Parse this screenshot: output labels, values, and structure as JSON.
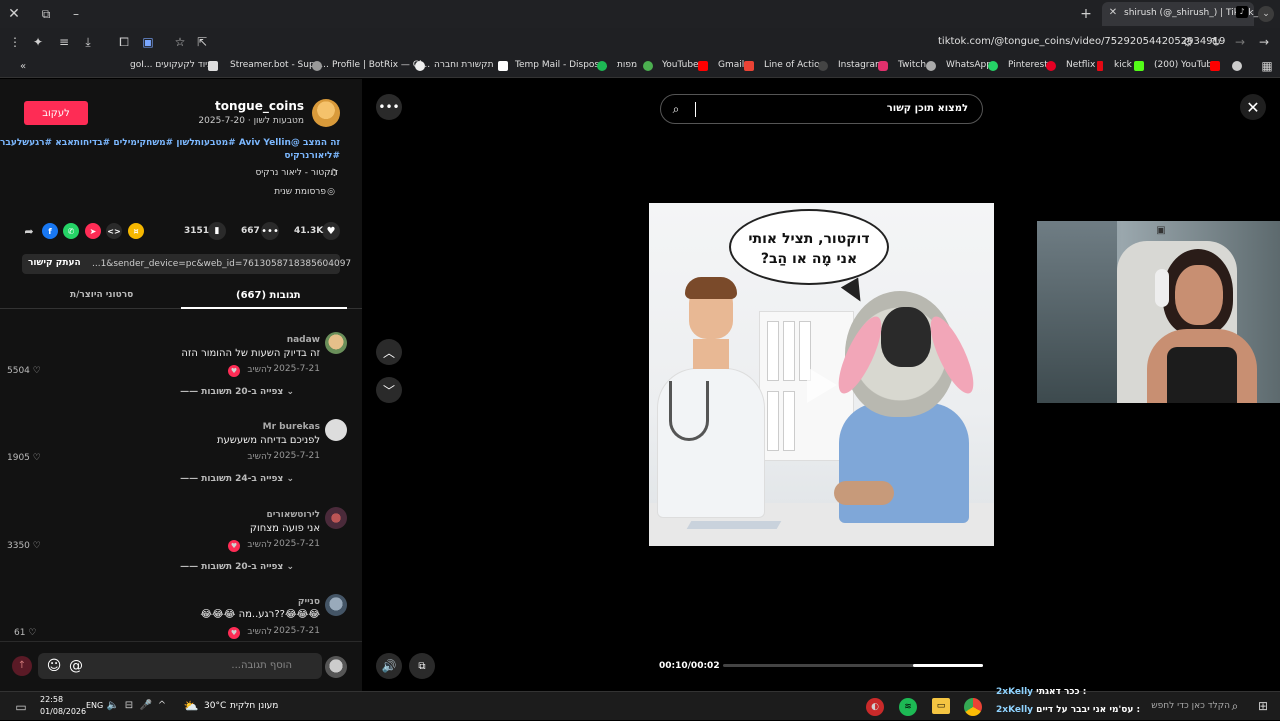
{
  "browser": {
    "tab_title": "shirush (@_shirush_) | TikTok_",
    "url": "tiktok.com/@tongue_coins/video/7529205442052934919",
    "bookmarks": [
      "goI... ציוד לקעקועים",
      "Streamer.bot - Supe...",
      "Profile | BotRix — Cl...",
      "תקשורת וחברה",
      "Temp Mail - Dispos...",
      "מפות",
      "YouTube",
      "Gmail",
      "Line of Action",
      "Instagram",
      "Twitch",
      "WhatsApp",
      "Pinterest",
      "Netflix",
      "kick",
      "(200) YouTube"
    ]
  },
  "post": {
    "username": "tongue_coins",
    "subtitle": "מטבעות לשון · 2025-7-20",
    "follow_label": "לעקוב",
    "description_line1": "זה המצב @Aviv Yellin #מטבעותלשון #משחקימילים #בדיחותאבא #רגעשלעברית",
    "description_line2": "#ליאורנרקיס",
    "music": "דוקטור - ליאור נרקיס",
    "promo": "פרסומת שנית",
    "likes": "41.3K",
    "comments": "667",
    "saves": "3151",
    "link_text": "...1&sender_device=pc&web_id=7613058718385604097",
    "copy_link_label": "העתק קישור",
    "tab_comments": "(667) תגובות",
    "tab_creator": "סרטוני היוצר/ת",
    "add_comment_placeholder": "הוסף תגובה..."
  },
  "comments": [
    {
      "name": "nadaw",
      "text": "זה בדיוק השעות של ההומור הזה",
      "date": "2025-7-21",
      "reply": "להשיב",
      "likes": "5504",
      "view_replies": "צפייה ב-20 תשובות"
    },
    {
      "name": "Mr burekas",
      "text": "לפניכם בדיחה משעשעת",
      "date": "2025-7-21",
      "reply": "להשיב",
      "likes": "1905",
      "view_replies": "צפייה ב-24 תשובות"
    },
    {
      "name": "לירוטשאורים",
      "text": "אני פועה מצחוק",
      "date": "2025-7-21",
      "reply": "להשיב",
      "likes": "3350",
      "view_replies": "צפייה ב-20 תשובות"
    },
    {
      "name": "סנייק",
      "text": "😂😂😂 רגע..מה??😂😂😂",
      "date": "2025-7-21",
      "reply": "להשיב",
      "likes": "61",
      "view_replies": ""
    }
  ],
  "video": {
    "search_placeholder": "למצוא תוכן קשור",
    "speech_line1": "דוקטור, תציל אותי",
    "speech_line2": "אני מָה או הַב?",
    "time": "00:10/00:02",
    "progress": 0.73
  },
  "taskbar": {
    "time": "22:58",
    "date": "01/08/2026",
    "lang": "ENG",
    "weather": "30°C",
    "weather_label": "מעונן חלקית",
    "search_placeholder": "הקלד כאן כדי לחפש",
    "chat1_name": "2xKelly",
    "chat1_text": "ככר דאגתי :",
    "chat2_name": "2xKelly",
    "chat2_text": "עס'מי אני יבבר על דיים :"
  },
  "colors": {
    "follow": "#fe2c55",
    "link": "#7cb8ff",
    "progress": "#ffffff"
  }
}
